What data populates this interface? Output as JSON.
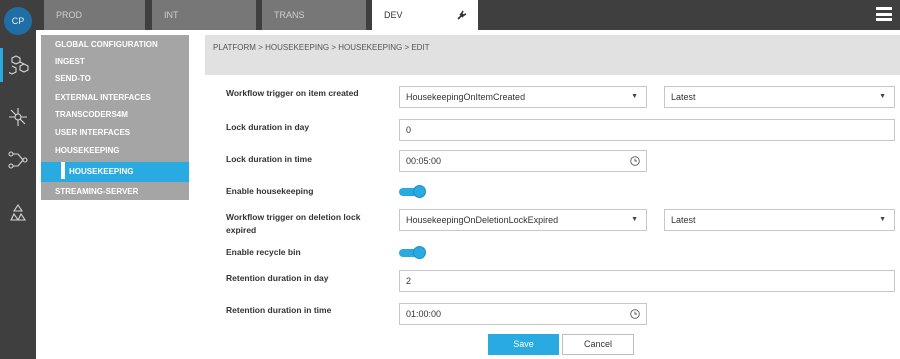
{
  "rail": {
    "logo": "CP",
    "icons": [
      "cubes-icon",
      "network-icon",
      "share-flow-icon",
      "recycle-icon"
    ]
  },
  "tabs": [
    {
      "label": "PROD"
    },
    {
      "label": "INT"
    },
    {
      "label": "TRANS"
    },
    {
      "label": "DEV"
    }
  ],
  "nav": {
    "items": [
      {
        "label": "GLOBAL CONFIGURATION"
      },
      {
        "label": "INGEST"
      },
      {
        "label": "SEND-TO"
      },
      {
        "label": "EXTERNAL INTERFACES"
      },
      {
        "label": "TRANSCODERS4M"
      },
      {
        "label": "USER INTERFACES"
      },
      {
        "label": "HOUSEKEEPING"
      },
      {
        "label": "HOUSEKEEPING"
      },
      {
        "label": "STREAMING-SERVER"
      }
    ]
  },
  "breadcrumb": "PLATFORM > HOUSEKEEPING > HOUSEKEEPING > EDIT",
  "form": {
    "trigger_created": {
      "label": "Workflow trigger on item created",
      "value": "HousekeepingOnItemCreated",
      "version": "Latest"
    },
    "lock_day": {
      "label": "Lock duration in day",
      "value": "0"
    },
    "lock_time": {
      "label": "Lock duration in time",
      "value": "00:05:00"
    },
    "enable_housekeeping": {
      "label": "Enable housekeeping",
      "on": true
    },
    "trigger_deletion": {
      "label": "Workflow trigger on deletion lock expired",
      "value": "HousekeepingOnDeletionLockExpired",
      "version": "Latest"
    },
    "enable_recycle": {
      "label": "Enable recycle bin",
      "on": true
    },
    "retention_day": {
      "label": "Retention duration in day",
      "value": "2"
    },
    "retention_time": {
      "label": "Retention duration in time",
      "value": "01:00:00"
    }
  },
  "buttons": {
    "save": "Save",
    "cancel": "Cancel"
  },
  "colors": {
    "accent": "#29abe2",
    "rail": "#3f3f3f",
    "sidebar": "#a5a5a5"
  }
}
